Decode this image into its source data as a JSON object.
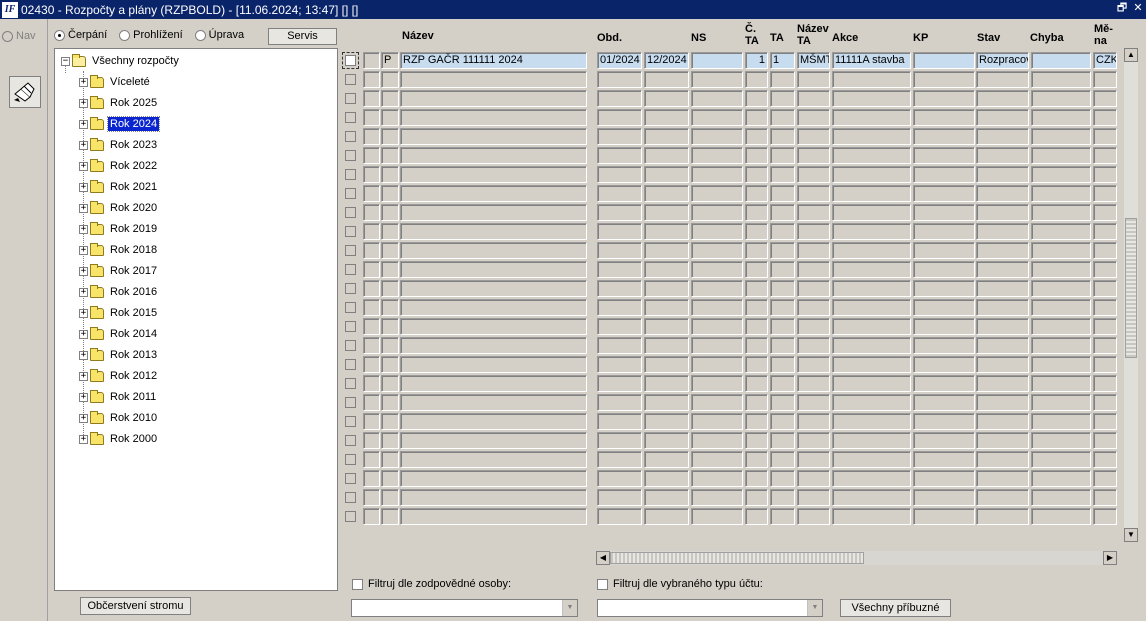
{
  "window": {
    "title": "02430 - Rozpočty a plány (RZPBOLD) - [11.06.2024; 13:47] [] []",
    "logo_text": "IF",
    "restore_glyph": "🗗",
    "close_glyph": "✕"
  },
  "nav": {
    "label": "Nav"
  },
  "modes": [
    {
      "label": "Čerpání",
      "selected": true
    },
    {
      "label": "Prohlížení",
      "selected": false
    },
    {
      "label": "Úprava",
      "selected": false
    }
  ],
  "servis_label": "Servis",
  "tree": {
    "root": "Všechny rozpočty",
    "selected": "Rok 2024",
    "items": [
      "Víceleté",
      "Rok 2025",
      "Rok 2024",
      "Rok 2023",
      "Rok 2022",
      "Rok 2021",
      "Rok 2020",
      "Rok 2019",
      "Rok 2018",
      "Rok 2017",
      "Rok 2016",
      "Rok 2015",
      "Rok 2014",
      "Rok 2013",
      "Rok 2012",
      "Rok 2011",
      "Rok 2010",
      "Rok 2000"
    ]
  },
  "refresh_label": "Občerstvení stromu",
  "grid": {
    "headers": {
      "nazev": "Název",
      "obd": "Obd.",
      "ns": "NS",
      "cta": "Č.\nTA",
      "ta": "TA",
      "nazev_ta": "Název\nTA",
      "akce": "Akce",
      "kp": "KP",
      "stav": "Stav",
      "chyba": "Chyba",
      "mena": "Mě-\nna"
    },
    "row_count": 25,
    "rows": [
      {
        "type": "P",
        "nazev": "RZP GAČR 111111 2024",
        "obd_from": "01/2024",
        "obd_to": "12/2024",
        "ns": "",
        "cta": "1",
        "ta": "1",
        "nazev_ta": "MŠMT",
        "akce": "11111A stavba",
        "kp": "",
        "stav": "Rozpracov",
        "chyba": "",
        "mena": "CZK"
      }
    ]
  },
  "filters": {
    "person_label": "Filtruj dle zodpovědné osoby:",
    "account_label": "Filtruj dle vybraného typu účtu:"
  },
  "related_label": "Všechny příbuzné",
  "colors": {
    "title_bar": "#0a246a",
    "selected_tree": "#0a24d0",
    "active_row": "#c8dcf0"
  }
}
